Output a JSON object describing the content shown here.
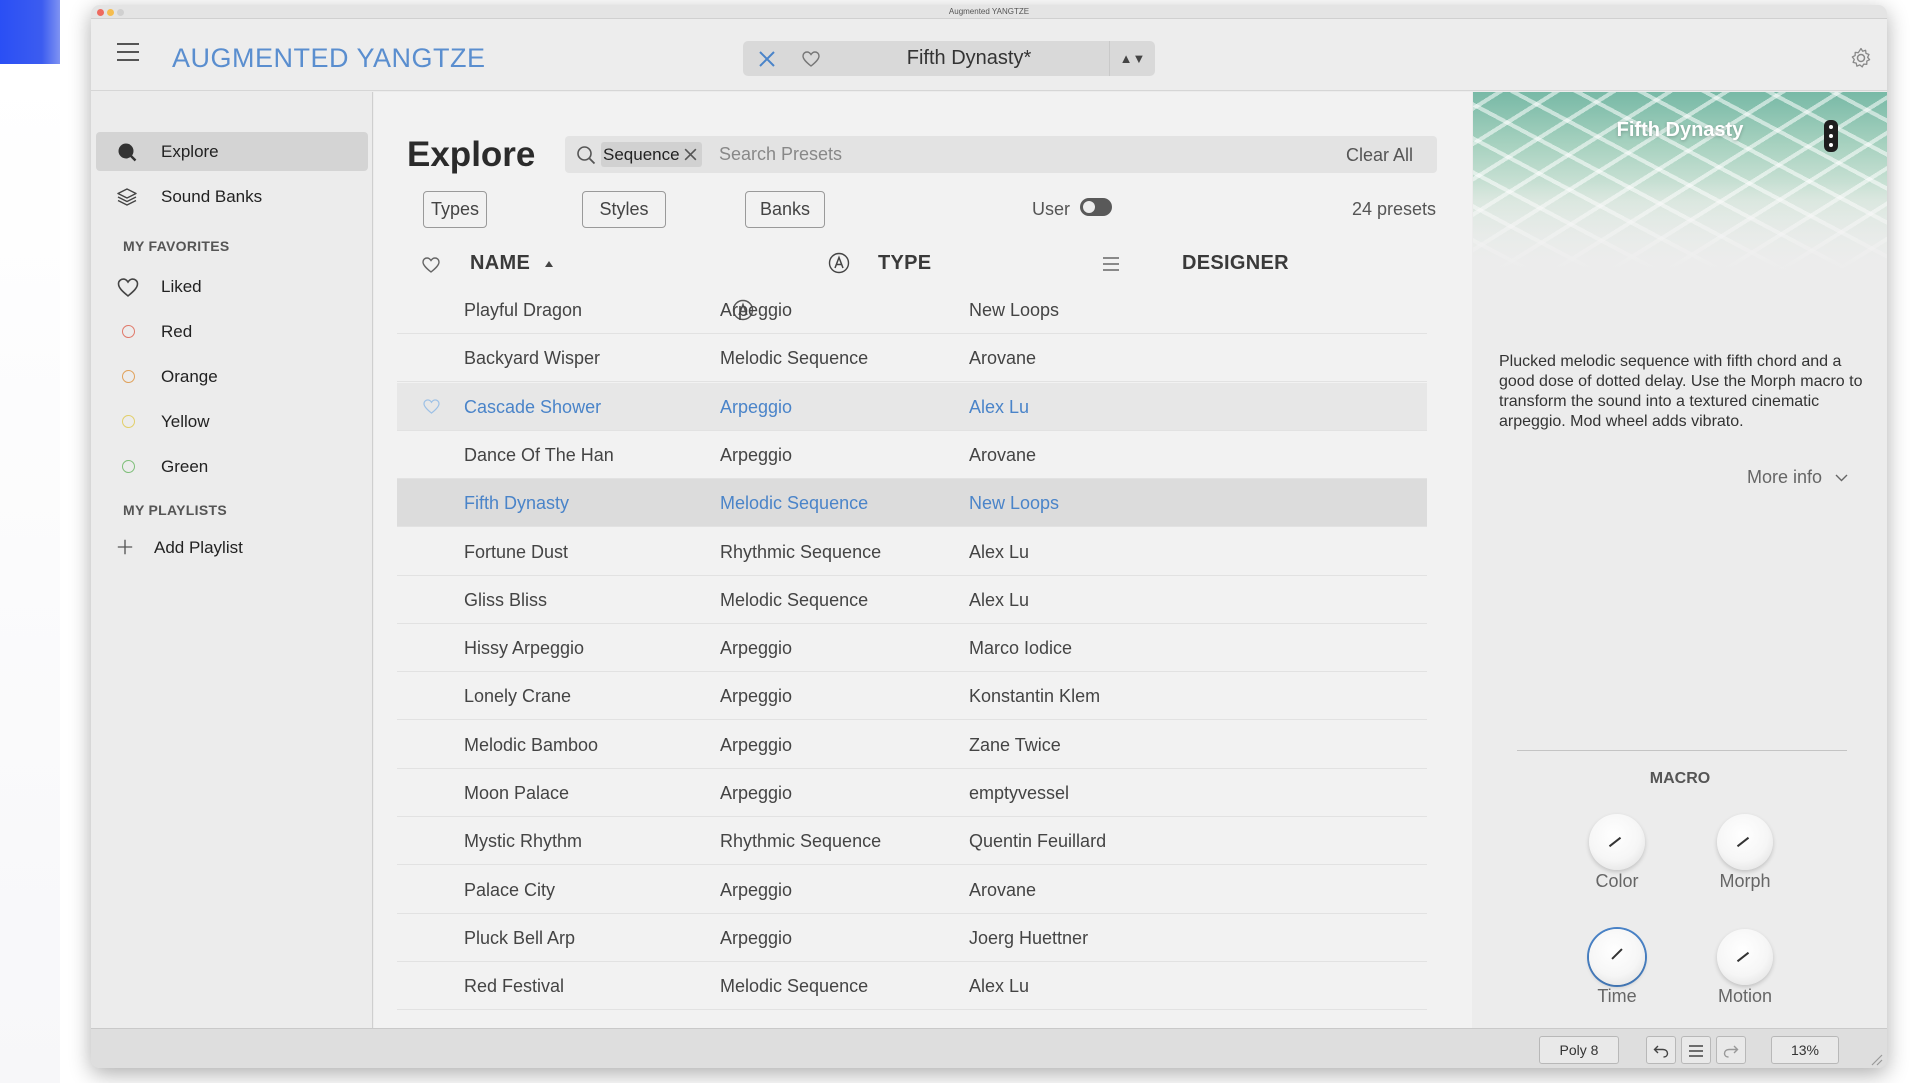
{
  "window": {
    "title": "Augmented YANGTZE"
  },
  "header": {
    "app_title": "AUGMENTED YANGTZE",
    "preset_name": "Fifth Dynasty*",
    "nav_arrows": "▲▼"
  },
  "sidebar": {
    "items": [
      {
        "label": "Explore"
      },
      {
        "label": "Sound Banks"
      }
    ],
    "favorites_heading": "MY FAVORITES",
    "favorites": [
      {
        "label": "Liked"
      },
      {
        "label": "Red",
        "color": "#e07a6b"
      },
      {
        "label": "Orange",
        "color": "#e0a25c"
      },
      {
        "label": "Yellow",
        "color": "#e2cf6a"
      },
      {
        "label": "Green",
        "color": "#7fbf7a"
      }
    ],
    "playlists_heading": "MY PLAYLISTS",
    "add_playlist": "Add Playlist"
  },
  "main": {
    "title": "Explore",
    "search": {
      "chip": "Sequence",
      "placeholder": "Search Presets",
      "clear_all": "Clear All"
    },
    "filters": [
      "Types",
      "Styles",
      "Banks"
    ],
    "user_label": "User",
    "preset_count": "24 presets",
    "columns": {
      "name": "NAME",
      "type": "TYPE",
      "designer": "DESIGNER"
    },
    "rows": [
      {
        "name": "Playful Dragon",
        "type": "Arpeggio",
        "designer": "New Loops"
      },
      {
        "name": "Backyard Wisper",
        "type": "Melodic Sequence",
        "designer": "Arovane"
      },
      {
        "name": "Cascade Shower",
        "type": "Arpeggio",
        "designer": "Alex Lu"
      },
      {
        "name": "Dance Of The Han",
        "type": "Arpeggio",
        "designer": "Arovane"
      },
      {
        "name": "Fifth Dynasty",
        "type": "Melodic Sequence",
        "designer": "New Loops"
      },
      {
        "name": "Fortune Dust",
        "type": "Rhythmic Sequence",
        "designer": "Alex Lu"
      },
      {
        "name": "Gliss Bliss",
        "type": "Melodic Sequence",
        "designer": "Alex Lu"
      },
      {
        "name": "Hissy Arpeggio",
        "type": "Arpeggio",
        "designer": "Marco Iodice"
      },
      {
        "name": "Lonely Crane",
        "type": "Arpeggio",
        "designer": "Konstantin Klem"
      },
      {
        "name": "Melodic Bamboo",
        "type": "Arpeggio",
        "designer": "Zane Twice"
      },
      {
        "name": "Moon Palace",
        "type": "Arpeggio",
        "designer": "emptyvessel"
      },
      {
        "name": "Mystic Rhythm",
        "type": "Rhythmic Sequence",
        "designer": "Quentin Feuillard"
      },
      {
        "name": "Palace City",
        "type": "Arpeggio",
        "designer": "Arovane"
      },
      {
        "name": "Pluck Bell Arp",
        "type": "Arpeggio",
        "designer": "Joerg Huettner"
      },
      {
        "name": "Red Festival",
        "type": "Melodic Sequence",
        "designer": "Alex Lu"
      }
    ]
  },
  "details": {
    "title": "Fifth Dynasty",
    "description": "Plucked melodic sequence with fifth chord and a good dose of dotted delay. Use the Morph macro to transform the sound into a textured cinematic arpeggio. Mod wheel adds vibrato.",
    "more_info": "More info",
    "macro_title": "MACRO",
    "knobs": [
      {
        "label": "Color"
      },
      {
        "label": "Morph"
      },
      {
        "label": "Time"
      },
      {
        "label": "Motion"
      }
    ]
  },
  "bottom": {
    "poly": "Poly 8",
    "zoom": "13%"
  },
  "colors": {
    "accent": "#4a84c9",
    "background": "#ececec"
  }
}
